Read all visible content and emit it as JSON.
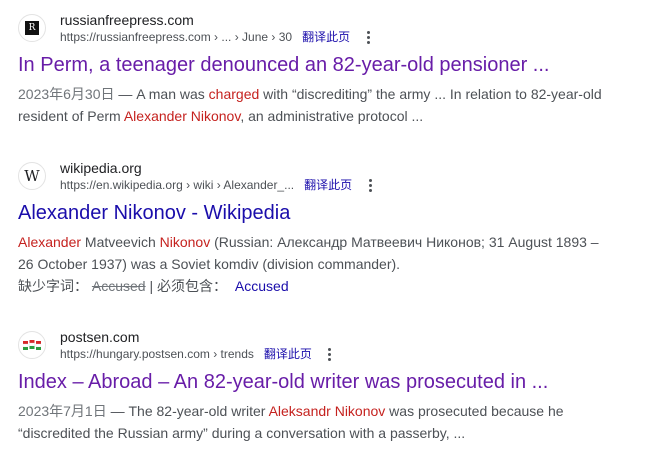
{
  "results": [
    {
      "site_name": "russianfreepress.com",
      "url": "https://russianfreepress.com › ... › June › 30",
      "translate_label": "翻译此页",
      "favicon": {
        "icon": "rfp-logo-icon",
        "glyph": "R"
      },
      "title": "In Perm, a teenager denounced an 82-year-old pensioner ...",
      "snippet_date": "2023年6月30日",
      "snippet_line1_a": " — A man was ",
      "snippet_line1_hl": "charged",
      "snippet_line1_b": " with “discrediting” the army ... In relation to 82-year-old",
      "snippet_line2_a": "resident of Perm ",
      "snippet_line2_hl": "Alexander Nikonov",
      "snippet_line2_b": ", an administrative protocol ..."
    },
    {
      "site_name": "wikipedia.org",
      "url": "https://en.wikipedia.org › wiki › Alexander_...",
      "translate_label": "翻译此页",
      "favicon": {
        "icon": "wikipedia-w-icon",
        "glyph": "W"
      },
      "title": "Alexander Nikonov - Wikipedia",
      "snippet_hl1": "Alexander",
      "snippet_mid1": " Matveevich ",
      "snippet_hl2": "Nikonov",
      "snippet_line1_rest": " (Russian: Александр Матвеевич Никонов; 31 August 1893 –",
      "snippet_line2": "26 October 1937) was a Soviet komdiv (division commander).",
      "missing_label": "缺少字词：",
      "missing_word": "Accused",
      "must_include_label": " | 必须包含：",
      "must_include_word": "Accused"
    },
    {
      "site_name": "postsen.com",
      "url": "https://hungary.postsen.com › trends",
      "translate_label": "翻译此页",
      "favicon": {
        "icon": "postsen-flags-icon"
      },
      "title": "Index – Abroad – An 82-year-old writer was prosecuted in ...",
      "snippet_date": "2023年7月1日",
      "snippet_line1_a": " — The 82-year-old writer ",
      "snippet_line1_hl": "Aleksandr Nikonov",
      "snippet_line1_b": " was prosecuted because he",
      "snippet_line2": "“discredited the Russian army” during a conversation with a passerby, ..."
    }
  ],
  "colors": {
    "link_visited": "#681da8",
    "link_unvisited": "#1a0dab",
    "highlight": "#c5221f",
    "text": "#4d5156"
  }
}
